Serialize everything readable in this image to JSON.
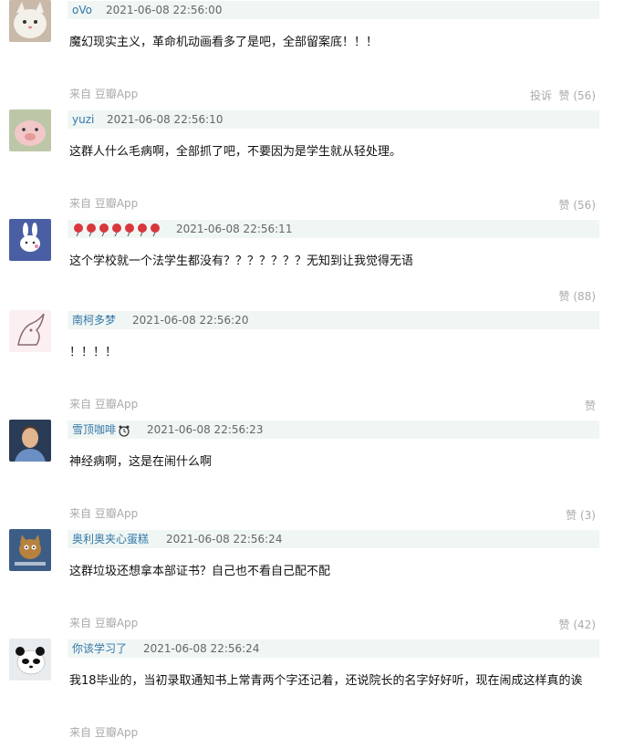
{
  "comments": [
    {
      "author": "oVo",
      "time": "2021-06-08 22:56:00",
      "text": "魔幻现实主义，革命机动画看多了是吧，全部留案底！！！",
      "source": "来自 豆瓣App",
      "report": "投诉",
      "likes": "赞 (56)",
      "avatar": "white-cat-avatar"
    },
    {
      "author": "yuzi",
      "time": "2021-06-08 22:56:10",
      "text": "这群人什么毛病啊，全部抓了吧，不要因为是学生就从轻处理。",
      "source": "来自 豆瓣App",
      "likes": "赞 (56)",
      "avatar": "pig-plush-avatar"
    },
    {
      "author": "",
      "time": "2021-06-08 22:56:11",
      "text": "这个学校就一个法学生都没有？？？？？？？无知到让我觉得无语",
      "likes": "赞 (88)",
      "avatar": "bunny-avatar"
    },
    {
      "author": "南柯多梦",
      "time": "2021-06-08 22:56:20",
      "text": "！！！！",
      "source": "来自 豆瓣App",
      "likes": "赞",
      "avatar": "fox-sketch-avatar"
    },
    {
      "author": "雪顶咖啡",
      "time": "2021-06-08 22:56:23",
      "text": "神经病啊，这是在闹什么啊",
      "source": "来自 豆瓣App",
      "likes": "赞 (3)",
      "avatar": "man-photo-avatar"
    },
    {
      "author": "奥利奥夹心蛋糕",
      "time": "2021-06-08 22:56:24",
      "text": "这群垃圾还想拿本部证书？自己也不看自己配不配",
      "source": "来自 豆瓣App",
      "likes": "赞 (42)",
      "avatar": "cartoon-cat-avatar"
    },
    {
      "author": "你该学习了",
      "time": "2021-06-08 22:56:24",
      "text": "我18毕业的，当初录取通知书上常青两个字还记着，还说院长的名字好好听，现在闹成这样真的诶",
      "source": "来自 豆瓣App",
      "avatar": "panda-avatar"
    }
  ],
  "colors": {
    "author": "#3377aa",
    "meta_bg": "#f0f6f3",
    "muted": "#aaaaaa",
    "text": "#111111"
  }
}
